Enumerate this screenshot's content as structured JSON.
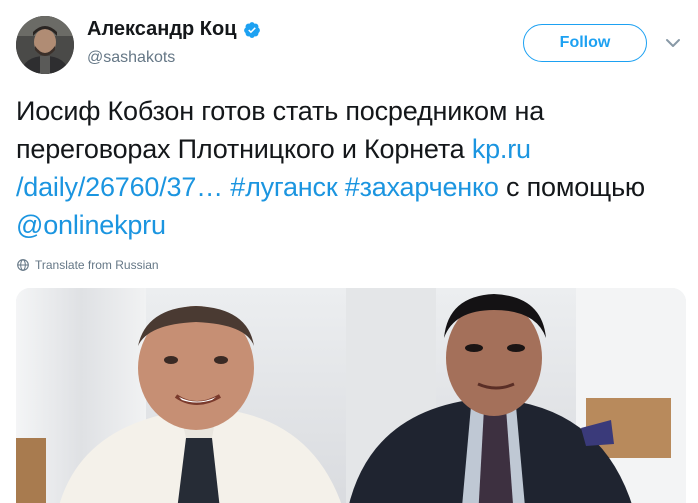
{
  "author": {
    "name": "Александр Коц",
    "handle": "@sashakots",
    "verified": true
  },
  "follow_button": {
    "label": "Follow"
  },
  "tweet": {
    "text_part1": "Иосиф Кобзон готов стать посредником на переговорах Плотницкого и Корнета ",
    "link_url": "kp.ru /daily/26760/37…",
    "text_space1": " ",
    "hashtag1": "#луганск",
    "text_space2": " ",
    "hashtag2": "#захарченко",
    "text_part2": " с помощью ",
    "mention": "@onlinekpru"
  },
  "translate": {
    "label": "Translate from Russian"
  },
  "icons": {
    "verified": "verified-badge-icon",
    "more": "chevron-down-icon",
    "translate": "globe-icon"
  },
  "colors": {
    "link": "#1b95e0",
    "follow_border": "#1da1f2",
    "secondary_text": "#657786",
    "primary_text": "#14171a"
  }
}
